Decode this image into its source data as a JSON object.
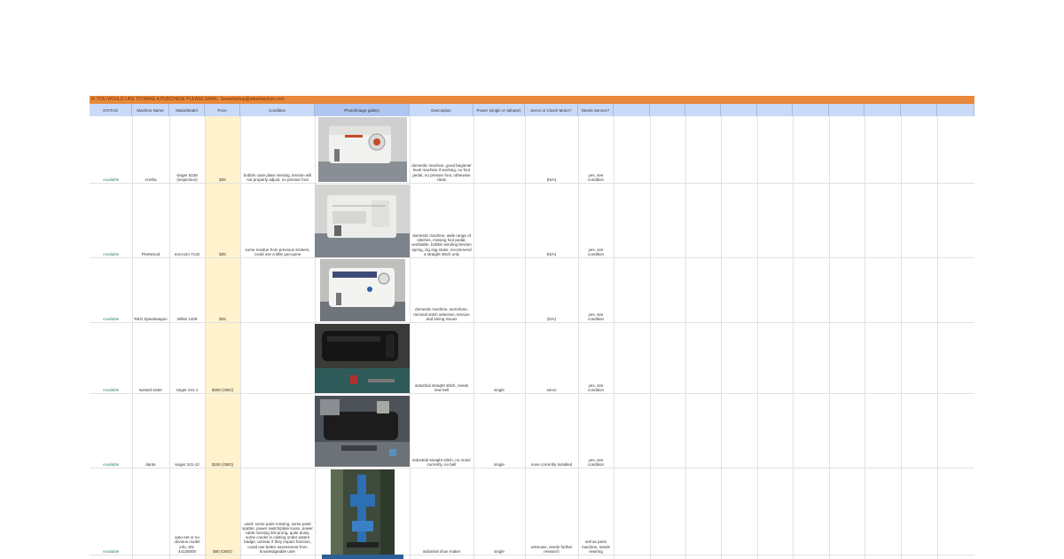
{
  "banner": "IF YOU WOULD LIKE TO MAKE A PURCHASE PLEASE EMAIL: Sewerbshop@atlantasylum.com",
  "headers": [
    "STATUS",
    "Machine Name",
    "Make/Model",
    "Price",
    "Condition",
    "Photo/image gallery",
    "Description",
    "Power (single or 3phase)",
    "Servo or Clutch Motor?",
    "Needs Service?"
  ],
  "rows": [
    {
      "status": "Available",
      "name": "Aretha",
      "model": "singer 6238 (inspection)",
      "price": "$25",
      "condition": "bobbin case plate missing, tension will not properly adjust, no presser foot",
      "description": "domestic machine, good beginner level machine if working, no foot pedal, no presser foot, otherwise clean",
      "power": "",
      "motor": "(N/A)",
      "service": "yes, see condition"
    },
    {
      "status": "Available",
      "name": "Fleetwood",
      "model": "euro-pro 7132",
      "price": "$25",
      "condition": "some residue from previous stickers, could use a little goo-gone",
      "description": "domestic machine, wide range of stitches, missing foot pedal, worktable, bobbin winding tension spring, zig zag stoke, recommend a straight stitch only",
      "power": "",
      "motor": "(N/A)",
      "service": "yes, see condition"
    },
    {
      "status": "Available",
      "name": "REO Speedwagon",
      "model": "White 1409",
      "price": "$25",
      "condition": "",
      "description": "domestic machine, worn/tone, minimal stitch selection, tension and timing issues",
      "power": "",
      "motor": "(N/A)",
      "service": "yes, see condition"
    },
    {
      "status": "Available",
      "name": "twisted sister",
      "model": "singer 241-1",
      "price": "$300 (OBO)",
      "condition": "",
      "description": "industrial straight stitch, needs new belt",
      "power": "single",
      "motor": "servo",
      "service": "yes, see condition"
    },
    {
      "status": "Available",
      "name": "dante",
      "model": "singer 241-12",
      "price": "$150 (OBO)",
      "condition": "",
      "description": "industrial straight stitch, no motor currently, no belt",
      "power": "single",
      "motor": "none currently installed",
      "service": "yes, see condition"
    },
    {
      "status": "Available",
      "name": "",
      "model": "auto-set or no obvious model info, SN: 44130000",
      "price": "$80 (OBO)",
      "condition": "used: some paint missing, some paint spatter, power switch/plate loose, power cable missing 3rd prong, quite dusty, some cracks in casting under patent badge, unclear if they impact function, could use better assessment from knowledgeable user",
      "description": "industrial shoe maker",
      "power": "single",
      "motor": "unknown, needs further research",
      "service": "sell as parts machine, needs rewiring"
    }
  ],
  "colors": {
    "banner": "#e8883a",
    "header": "#c9daf8",
    "price_bg": "#fff2cc",
    "status": "#2e8b57"
  }
}
